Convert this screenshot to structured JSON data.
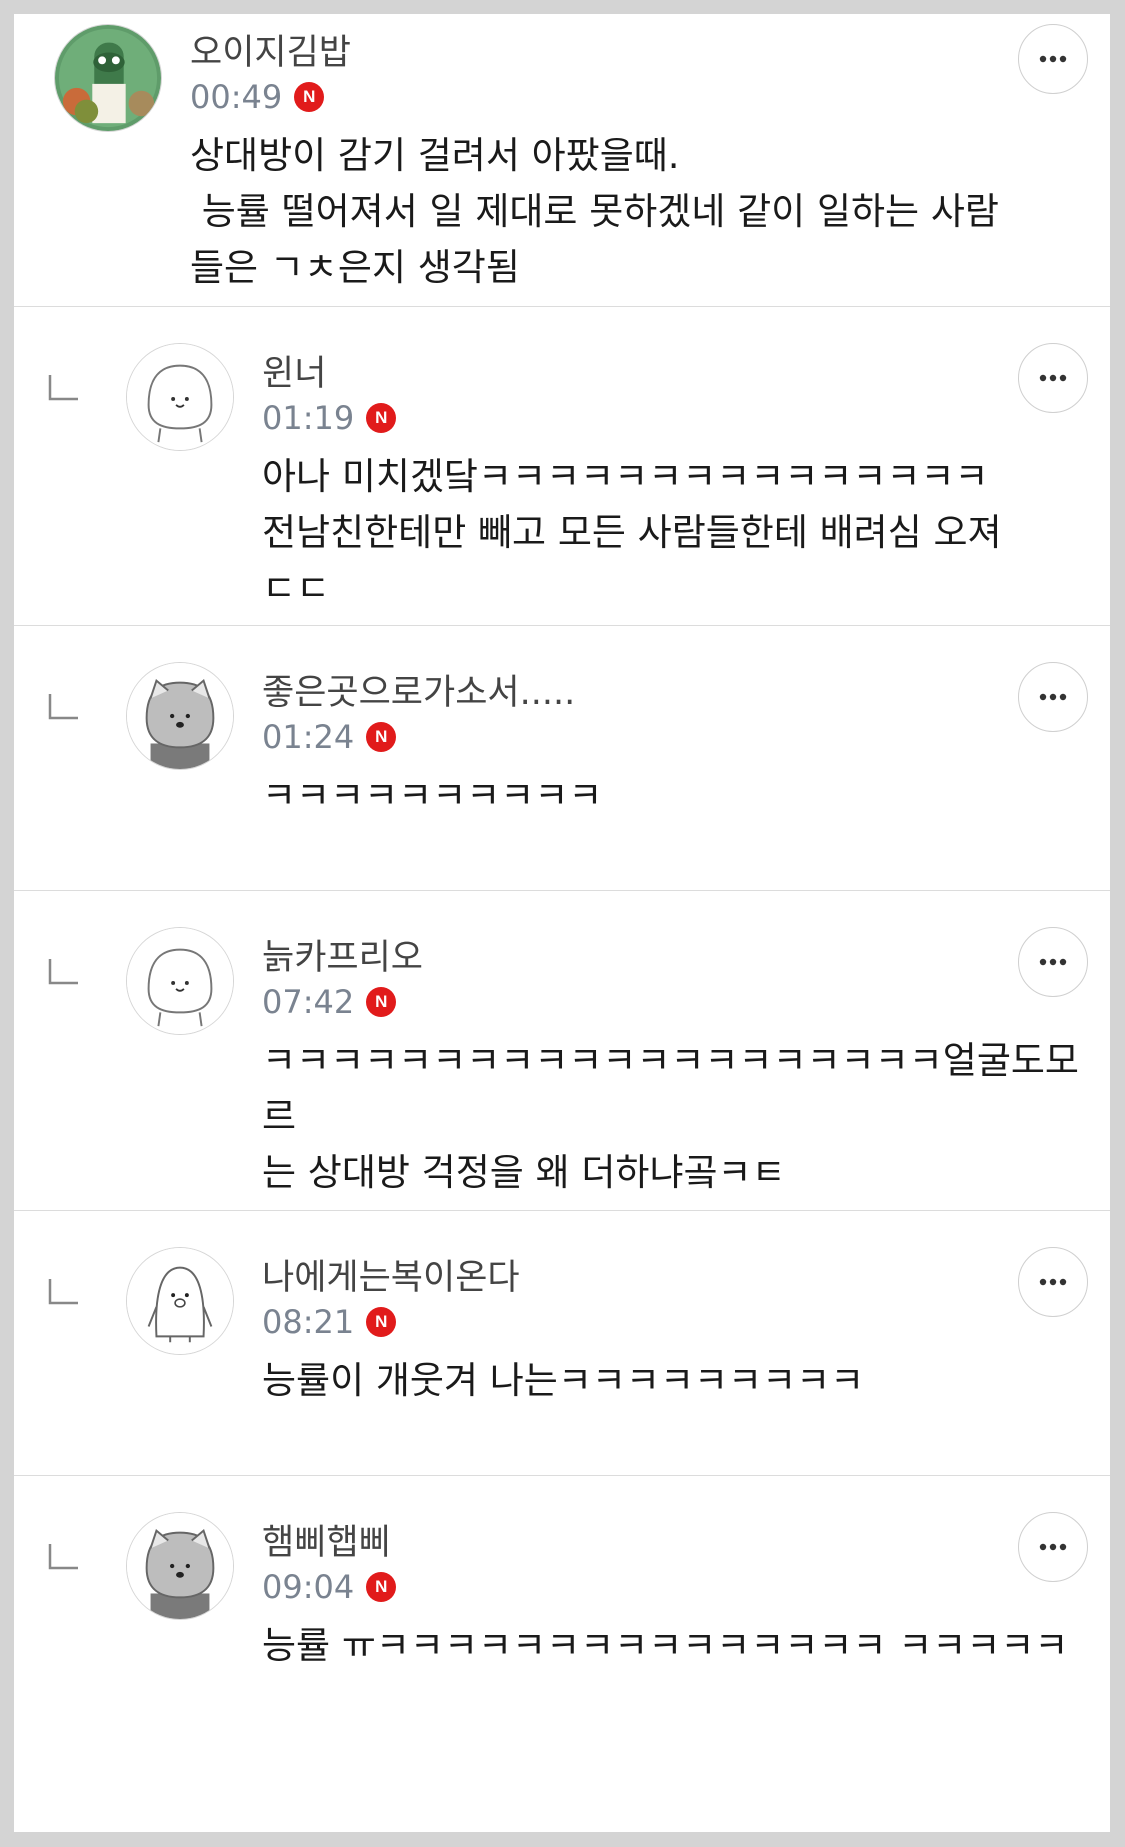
{
  "comments": [
    {
      "nickname": "오이지김밥",
      "time": "00:49",
      "new_badge": "N",
      "text": "상대방이 감기 걸려서 아팠을때.\n 능률 떨어져서 일 제대로 못하겠네 같이 일하는 사람\n들은 ㄱㅊ은지 생각됨",
      "is_reply": false,
      "avatar": "cartoon-characters-avatar"
    },
    {
      "nickname": "윈너",
      "time": "01:19",
      "new_badge": "N",
      "text": "아나 미치겠닼ㅋㅋㅋㅋㅋㅋㅋㅋㅋㅋㅋㅋㅋㅋㅋ\n전남친한테만 빼고 모든 사람들한테 배려심 오져\nㄷㄷ",
      "is_reply": true,
      "avatar": "white-blob-avatar"
    },
    {
      "nickname": "좋은곳으로가소서.....",
      "time": "01:24",
      "new_badge": "N",
      "text": "ㅋㅋㅋㅋㅋㅋㅋㅋㅋㅋ",
      "is_reply": true,
      "avatar": "gray-cat-avatar"
    },
    {
      "nickname": "늙카프리오",
      "time": "07:42",
      "new_badge": "N",
      "text": "ㅋㅋㅋㅋㅋㅋㅋㅋㅋㅋㅋㅋㅋㅋㅋㅋㅋㅋㅋㅋ얼굴도모르\n는 상대방 걱정을 왜 더하냐곸ㅋㅌ",
      "is_reply": true,
      "avatar": "white-blob-avatar"
    },
    {
      "nickname": "나에게는복이온다",
      "time": "08:21",
      "new_badge": "N",
      "text": "능률이 개웃겨 나는ㅋㅋㅋㅋㅋㅋㅋㅋㅋ",
      "is_reply": true,
      "avatar": "penguin-avatar"
    },
    {
      "nickname": "햄삐햅삐",
      "time": "09:04",
      "new_badge": "N",
      "text": "능률 ㅠㅋㅋㅋㅋㅋㅋㅋㅋㅋㅋㅋㅋㅋㅋㅋ ㅋㅋㅋㅋㅋ",
      "is_reply": true,
      "avatar": "gray-cat-avatar"
    }
  ],
  "icons": {
    "more": "more-horizontal-icon",
    "reply": "reply-arrow-icon"
  },
  "colors": {
    "new_badge": "#e11b1b",
    "time": "#7a8390",
    "background": "#d4d4d4"
  }
}
